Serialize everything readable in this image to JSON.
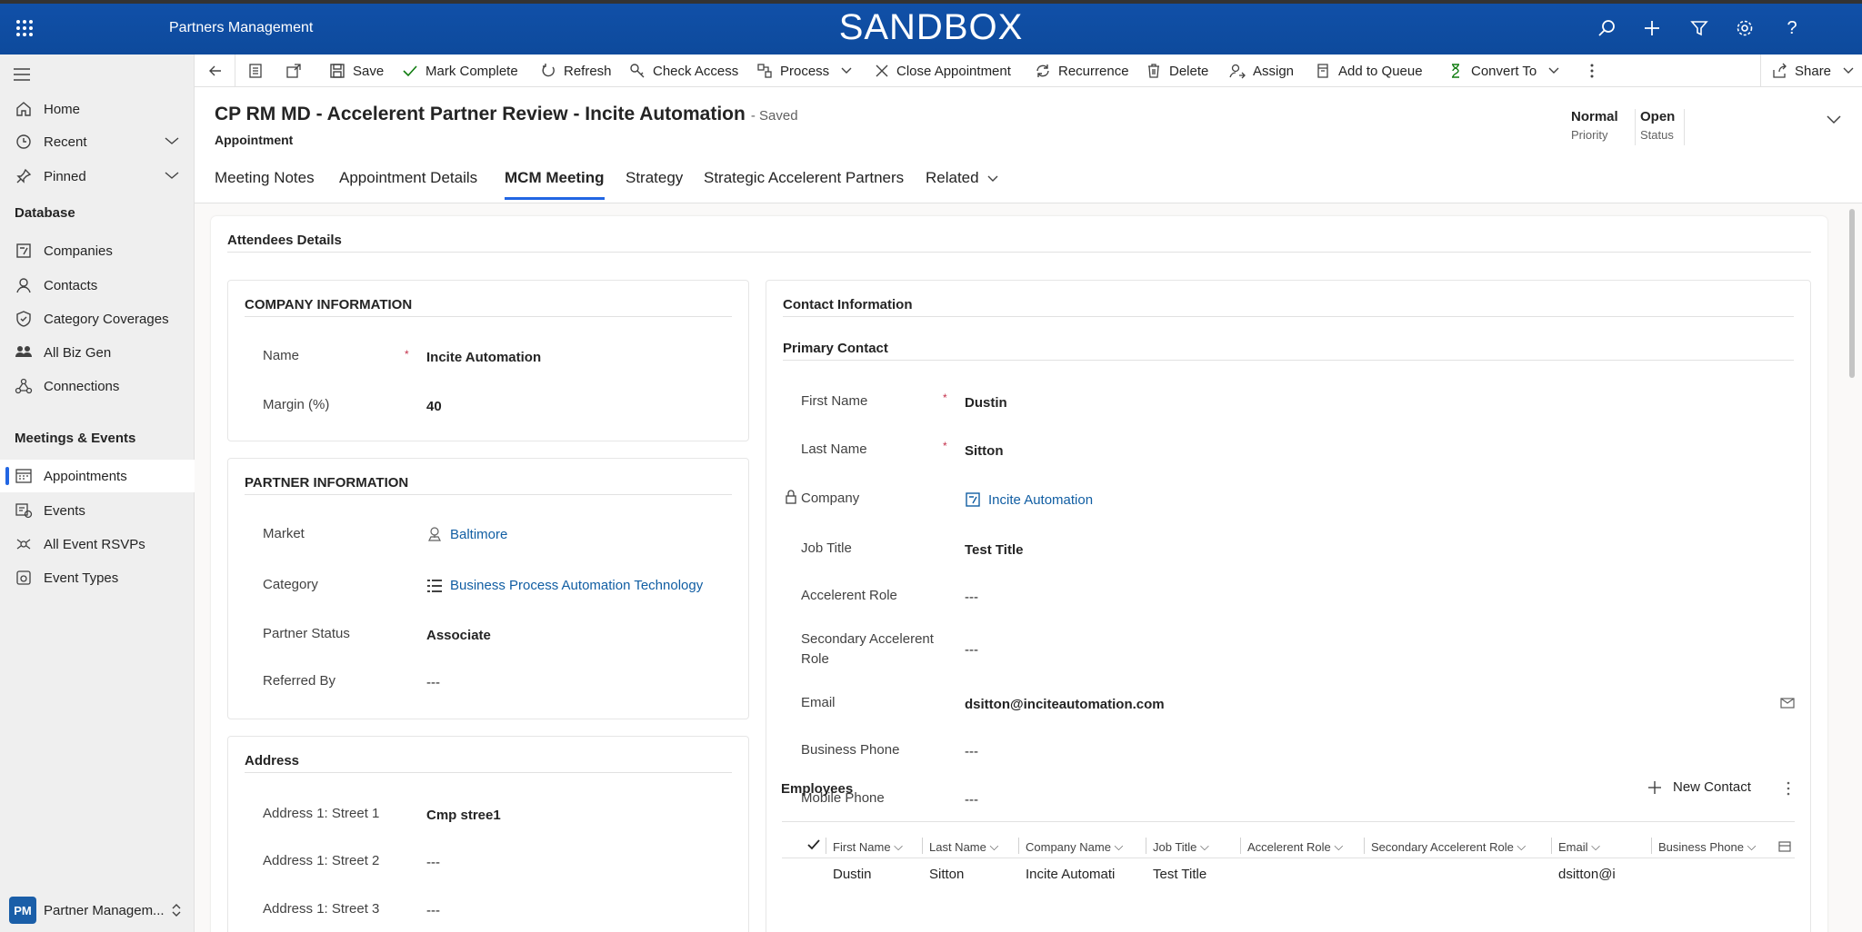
{
  "app": {
    "name": "Partners Management",
    "environment": "SANDBOX"
  },
  "sidebar": {
    "items": [
      {
        "label": "Home",
        "icon": "home-icon"
      },
      {
        "label": "Recent",
        "icon": "clock-icon"
      },
      {
        "label": "Pinned",
        "icon": "pin-icon"
      }
    ],
    "sections": [
      {
        "label": "Database",
        "items": [
          "Companies",
          "Contacts",
          "Category Coverages",
          "All Biz Gen",
          "Connections"
        ]
      },
      {
        "label": "Meetings & Events",
        "items": [
          "Appointments",
          "Events",
          "All Event RSVPs",
          "Event Types"
        ]
      }
    ],
    "area": {
      "badge": "PM",
      "label": "Partner Managem..."
    }
  },
  "commands": [
    "Save",
    "Mark Complete",
    "Refresh",
    "Check Access",
    "Process",
    "Close Appointment",
    "Recurrence",
    "Delete",
    "Assign",
    "Add to Queue",
    "Convert To",
    "Share"
  ],
  "record": {
    "title": "CP RM MD - Accelerent Partner Review - Incite Automation",
    "saved": "- Saved",
    "type": "Appointment",
    "priority": {
      "value": "Normal",
      "label": "Priority"
    },
    "status": {
      "value": "Open",
      "label": "Status"
    }
  },
  "tabs": [
    "Meeting Notes",
    "Appointment Details",
    "MCM Meeting",
    "Strategy",
    "Strategic Accelerent Partners",
    "Related"
  ],
  "section_title": "Attendees Details",
  "company_info": {
    "title": "COMPANY INFORMATION",
    "name_label": "Name",
    "name_value": "Incite Automation",
    "margin_label": "Margin (%)",
    "margin_value": "40"
  },
  "partner_info": {
    "title": "PARTNER INFORMATION",
    "market_label": "Market",
    "market_value": "Baltimore",
    "category_label": "Category",
    "category_value": "Business Process Automation Technology",
    "status_label": "Partner Status",
    "status_value": "Associate",
    "referred_label": "Referred By",
    "referred_value": "---"
  },
  "address": {
    "title": "Address",
    "street1_label": "Address 1: Street 1",
    "street1_value": "Cmp stree1",
    "street2_label": "Address 1: Street 2",
    "street2_value": "---",
    "street3_label": "Address 1: Street 3",
    "street3_value": "---"
  },
  "contact_info": {
    "title": "Contact Information",
    "primary_title": "Primary Contact",
    "first_name_label": "First Name",
    "first_name_value": "Dustin",
    "last_name_label": "Last Name",
    "last_name_value": "Sitton",
    "company_label": "Company",
    "company_value": "Incite Automation",
    "job_title_label": "Job Title",
    "job_title_value": "Test Title",
    "role_label": "Accelerent Role",
    "role_value": "---",
    "sec_role_label_1": "Secondary Accelerent",
    "sec_role_label_2": "Role",
    "sec_role_value": "---",
    "email_label": "Email",
    "email_value": "dsitton@inciteautomation.com",
    "bphone_label": "Business Phone",
    "bphone_value": "---",
    "mphone_label": "Mobile Phone",
    "mphone_value": "---"
  },
  "employees": {
    "title": "Employees",
    "new_label": "New Contact",
    "columns": [
      "First Name",
      "Last Name",
      "Company Name",
      "Job Title",
      "Accelerent Role",
      "Secondary Accelerent Role",
      "Email",
      "Business Phone"
    ],
    "rows": [
      [
        "Dustin",
        "Sitton",
        "Incite Automati",
        "Test Title",
        "",
        "",
        "dsitton@i",
        ""
      ]
    ]
  }
}
